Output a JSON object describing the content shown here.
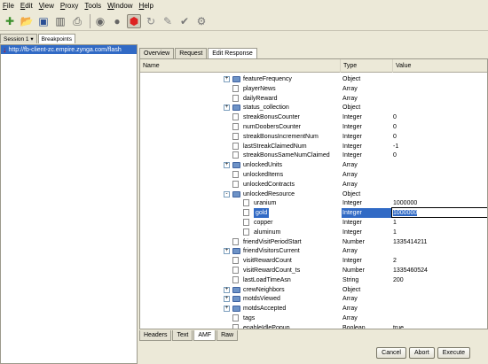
{
  "menu": [
    {
      "label": "File",
      "u": "F",
      "rest": "ile"
    },
    {
      "label": "Edit",
      "u": "E",
      "rest": "dit"
    },
    {
      "label": "View",
      "u": "V",
      "rest": "iew"
    },
    {
      "label": "Proxy",
      "u": "P",
      "rest": "roxy"
    },
    {
      "label": "Tools",
      "u": "T",
      "rest": "ools"
    },
    {
      "label": "Window",
      "u": "W",
      "rest": "indow"
    },
    {
      "label": "Help",
      "u": "H",
      "rest": "elp"
    }
  ],
  "toolbar": {
    "icons": [
      "new-icon",
      "open-icon",
      "save-icon",
      "delete-icon",
      "print-icon",
      "throttle-icon",
      "record-icon",
      "breakpoint-icon",
      "repeat-icon",
      "edit-icon",
      "validate-icon",
      "settings-icon"
    ]
  },
  "left": {
    "tabs": [
      "Session 1",
      "Breakpoints"
    ],
    "session_url": "http://fb-client-zc.empire.zynga.com/flash"
  },
  "right": {
    "tabs": [
      "Overview",
      "Request",
      "Edit Response"
    ],
    "columns": {
      "name": "Name",
      "type": "Type",
      "value": "Value"
    },
    "rows": [
      {
        "name": "featureFrequency",
        "type": "Object",
        "value": "",
        "kind": "folder",
        "level": 0,
        "exp": "+"
      },
      {
        "name": "playerNews",
        "type": "Array",
        "value": "",
        "kind": "leaf",
        "level": 0,
        "exp": ""
      },
      {
        "name": "dailyReward",
        "type": "Array",
        "value": "",
        "kind": "leaf",
        "level": 0,
        "exp": ""
      },
      {
        "name": "status_collection",
        "type": "Object",
        "value": "",
        "kind": "folder",
        "level": 0,
        "exp": "+"
      },
      {
        "name": "streakBonusCounter",
        "type": "Integer",
        "value": "0",
        "kind": "leaf",
        "level": 0,
        "exp": ""
      },
      {
        "name": "numDoobersCounter",
        "type": "Integer",
        "value": "0",
        "kind": "leaf",
        "level": 0,
        "exp": ""
      },
      {
        "name": "streakBonusIncrementNum",
        "type": "Integer",
        "value": "0",
        "kind": "leaf",
        "level": 0,
        "exp": ""
      },
      {
        "name": "lastStreakClaimedNum",
        "type": "Integer",
        "value": "-1",
        "kind": "leaf",
        "level": 0,
        "exp": ""
      },
      {
        "name": "streakBonusSameNumClaimed",
        "type": "Integer",
        "value": "0",
        "kind": "leaf",
        "level": 0,
        "exp": ""
      },
      {
        "name": "unlockedUnits",
        "type": "Array",
        "value": "",
        "kind": "folder",
        "level": 0,
        "exp": "+"
      },
      {
        "name": "unlockedItems",
        "type": "Array",
        "value": "",
        "kind": "leaf",
        "level": 0,
        "exp": ""
      },
      {
        "name": "unlockedContracts",
        "type": "Array",
        "value": "",
        "kind": "leaf",
        "level": 0,
        "exp": ""
      },
      {
        "name": "unlockedResource",
        "type": "Object",
        "value": "",
        "kind": "folder",
        "level": 0,
        "exp": "−"
      },
      {
        "name": "uranium",
        "type": "Integer",
        "value": "1000000",
        "kind": "leaf",
        "level": 1,
        "exp": ""
      },
      {
        "name": "gold",
        "type": "Integer",
        "value": "1000000",
        "kind": "leaf",
        "level": 1,
        "exp": "",
        "selected": true
      },
      {
        "name": "copper",
        "type": "Integer",
        "value": "1",
        "kind": "leaf",
        "level": 1,
        "exp": ""
      },
      {
        "name": "aluminum",
        "type": "Integer",
        "value": "1",
        "kind": "leaf",
        "level": 1,
        "exp": ""
      },
      {
        "name": "friendVisitPeriodStart",
        "type": "Number",
        "value": "1335414211",
        "kind": "leaf",
        "level": 0,
        "exp": ""
      },
      {
        "name": "friendVisitorsCurrent",
        "type": "Array",
        "value": "",
        "kind": "folder",
        "level": 0,
        "exp": "+"
      },
      {
        "name": "visitRewardCount",
        "type": "Integer",
        "value": "2",
        "kind": "leaf",
        "level": 0,
        "exp": ""
      },
      {
        "name": "visitRewardCount_ts",
        "type": "Number",
        "value": "1335460524",
        "kind": "leaf",
        "level": 0,
        "exp": ""
      },
      {
        "name": "lastLoadTimeAsn",
        "type": "String",
        "value": "200",
        "kind": "leaf",
        "level": 0,
        "exp": ""
      },
      {
        "name": "crewNeighbors",
        "type": "Object",
        "value": "",
        "kind": "folder",
        "level": 0,
        "exp": "+"
      },
      {
        "name": "motdsViewed",
        "type": "Array",
        "value": "",
        "kind": "folder",
        "level": 0,
        "exp": "+"
      },
      {
        "name": "motdsAccepted",
        "type": "Array",
        "value": "",
        "kind": "folder",
        "level": 0,
        "exp": "+"
      },
      {
        "name": "tags",
        "type": "Array",
        "value": "",
        "kind": "leaf",
        "level": 0,
        "exp": ""
      },
      {
        "name": "enableIdlePopup",
        "type": "Boolean",
        "value": "true",
        "kind": "leaf",
        "level": 0,
        "exp": ""
      }
    ],
    "bottom_tabs": [
      "Headers",
      "Text",
      "AMF",
      "Raw"
    ]
  },
  "buttons": {
    "cancel": "Cancel",
    "abort": "Abort",
    "execute": "Execute"
  },
  "colors": {
    "selection": "#316ac5",
    "folder": "#6e93c7",
    "breakpoint_arrow": "#d40000"
  }
}
